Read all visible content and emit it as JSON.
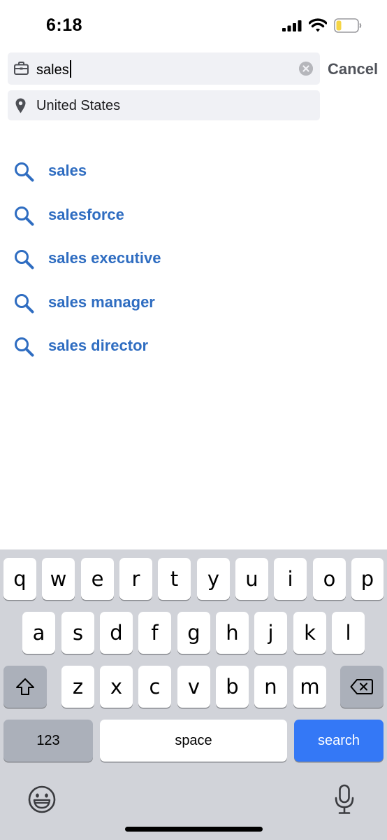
{
  "status_bar": {
    "time": "6:18",
    "icons": [
      "signal-icon",
      "wifi-icon",
      "battery-icon"
    ],
    "battery_color": "#f5d545"
  },
  "search": {
    "query": "sales",
    "location": "United States",
    "cancel_label": "Cancel",
    "icons": {
      "query": "briefcase-icon",
      "location": "pin-icon",
      "clear": "clear-icon"
    }
  },
  "suggestions": [
    {
      "label": "sales"
    },
    {
      "label": "salesforce"
    },
    {
      "label": "sales executive"
    },
    {
      "label": "sales manager"
    },
    {
      "label": "sales director"
    }
  ],
  "keyboard": {
    "row1": [
      "q",
      "w",
      "e",
      "r",
      "t",
      "y",
      "u",
      "i",
      "o",
      "p"
    ],
    "row2": [
      "a",
      "s",
      "d",
      "f",
      "g",
      "h",
      "j",
      "k",
      "l"
    ],
    "row3": [
      "z",
      "x",
      "c",
      "v",
      "b",
      "n",
      "m"
    ],
    "numbers_label": "123",
    "space_label": "space",
    "search_label": "search",
    "icons": [
      "shift-icon",
      "backspace-icon",
      "emoji-icon",
      "microphone-icon"
    ]
  },
  "colors": {
    "accent": "#2f6dc1",
    "search_key": "#3478f6",
    "field_bg": "#f0f1f5",
    "keyboard_bg": "#d1d3d9"
  }
}
